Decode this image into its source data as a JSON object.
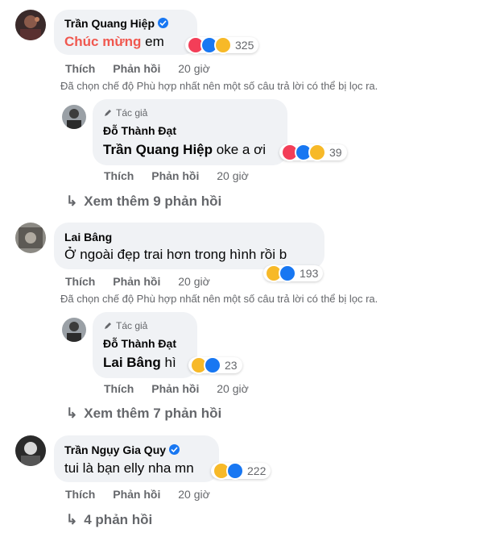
{
  "ui": {
    "like": "Thích",
    "reply": "Phản hồi",
    "author_badge": "Tác giả",
    "filter_notice": "Đã chọn chế độ Phù hợp nhất nên một số câu trả lời có thể bị lọc ra."
  },
  "comments": [
    {
      "author": "Trần Quang Hiệp",
      "verified": true,
      "text_highlight": "Chúc mừng",
      "text_rest": "em",
      "reactions": [
        "love",
        "like",
        "haha"
      ],
      "reaction_count": "325",
      "time": "20 giờ",
      "reply": {
        "author": "Đỗ Thành Đạt",
        "mention": "Trần Quang Hiệp",
        "text": "oke a ơi",
        "reactions": [
          "love",
          "like",
          "haha"
        ],
        "reaction_count": "39",
        "time": "20 giờ"
      },
      "more_replies": "Xem thêm 9 phản hồi"
    },
    {
      "author": "Lai Bâng",
      "text": "Ở ngoài đẹp trai hơn trong hình rồi b",
      "reactions": [
        "haha",
        "like"
      ],
      "reaction_count": "193",
      "time": "20 giờ",
      "reply": {
        "author": "Đỗ Thành Đạt",
        "mention": "Lai Bâng",
        "text": "hì",
        "reactions": [
          "haha",
          "like"
        ],
        "reaction_count": "23",
        "time": "20 giờ"
      },
      "more_replies": "Xem thêm 7 phản hồi"
    },
    {
      "author": "Trần Ngụy Gia Quy",
      "verified": true,
      "text": "tui là bạn elly nha mn",
      "reactions": [
        "haha",
        "like"
      ],
      "reaction_count": "222",
      "time": "20 giờ",
      "more_replies": "4 phản hồi"
    }
  ]
}
